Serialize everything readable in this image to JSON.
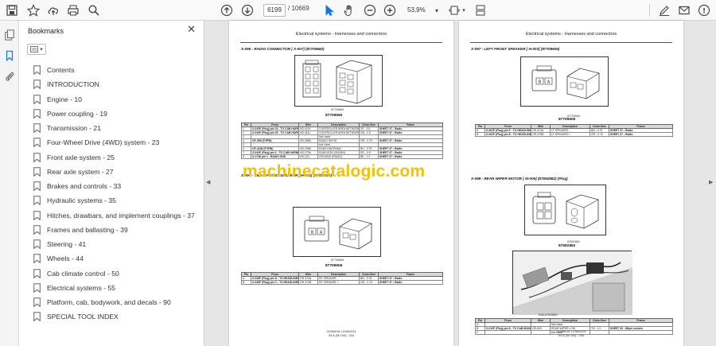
{
  "toolbar": {
    "current_page": "6199",
    "total_pages": "/ 10669",
    "zoom": "53,9%"
  },
  "bookmarks": {
    "title": "Bookmarks",
    "items": [
      "Contents",
      "INTRODUCTION",
      "Engine - 10",
      "Power coupling - 19",
      "Transmission - 21",
      "Four-Wheel Drive (4WD) system - 23",
      "Front axle system - 25",
      "Rear axle system - 27",
      "Brakes and controls - 33",
      "Hydraulic systems - 35",
      "Hitches, drawbars, and implement couplings - 37",
      "Frames and ballasting - 39",
      "Steering - 41",
      "Wheels - 44",
      "Cab climate control - 50",
      "Electrical systems - 55",
      "Platform, cab, bodywork, and decals - 90",
      "SPECIAL TOOL INDEX"
    ]
  },
  "left_page": {
    "header": "Electrical systems - Harnesses and connectors",
    "section1": "X-095 - RADIO CONNECTOR [ X-007] (87709660)",
    "caption1": "87709660",
    "partno1": "87709660",
    "table_headers": [
      "Pin",
      "From",
      "Wire",
      "Description",
      "Color-Size",
      "Frame"
    ],
    "table1": [
      [
        "1",
        "X-043F (Plug) pin 24 - TO CAB HARNESS (51146260)",
        "HD-410L",
        "CONTROLLER AREA NETWORK LINK HIGH",
        "YE - 0.5",
        "SHEET 37 - Radio"
      ],
      [
        "2",
        "X-043F (Plug) pin 25 - TO CAB HARNESS (51146260)",
        "HD-411L",
        "CONTROLLER AREA NETWORK LINK LOW",
        "GN - 0.5",
        "SHEET 37 - Radio"
      ],
      [
        "3",
        "",
        "",
        "Not Used",
        "",
        ""
      ],
      [
        "4",
        "OF-355 (PJPIN)",
        "HD-265A",
        "RADIO 30X B+",
        "OR - 0.75",
        "SHEET 37 - Radio"
      ],
      [
        "5",
        "",
        "",
        "Not Used",
        "",
        ""
      ],
      [
        "6",
        "OF-4238 (PJPIN)",
        "HD-238A",
        "RADIO ANTENNA",
        "BU - 0.75",
        "SHEET 37 - Radio"
      ],
      [
        "7",
        "X-043F (Plug) pin 3 - TO CAB HARNESS (51146260)",
        "HD-279A",
        "RADIO/15X (ON/IGN)",
        "RD - 0.5",
        "SHEET 37 - Radio"
      ],
      [
        "8",
        "X-1738 pin 1 - RADIO GND",
        "HD-223",
        "GROUND (RADIO)",
        "BK - 1.0",
        "SHEET 37 - Radio"
      ]
    ],
    "section2": "X-096 - RIGHT FRONT SPEAKER [ H-002] (87709606)",
    "caption2": "87709606",
    "partno2": "87709606",
    "table2": [
      [
        "A",
        "X-045F (Plug) pin D - TO HEADLINER SW HARNESS (87939641)",
        "OR-372A",
        "RF SPEAKER -",
        "BN - 0.75",
        "SHEET 37 - Radio"
      ],
      [
        "B",
        "X-045F (Plug) pin C - TO HEADLINER SW HARNESS (87939641)",
        "OR-373B",
        "RF SPEAKER +",
        "OR - 0.75",
        "SHEET 37 - Radio"
      ]
    ],
    "footer1": "32308018 12/08/2024",
    "footer2": "55.8 [55.100] / 344"
  },
  "right_page": {
    "header": "Electrical systems - Harnesses and connectors",
    "section1": "X-097 - LEFT FRONT SPEAKER [ H-003] (87709606)",
    "caption1": "87709606",
    "partno1": "87709606",
    "table_headers": [
      "Pin",
      "From",
      "Wire",
      "Description",
      "Color-Size",
      "Frame"
    ],
    "table1": [
      [
        "A",
        "X-061F (Plug) pin F - TO HEADLINER SW HARNESS (87939641)",
        "OR-374A",
        "LF SPEAKER -",
        "BN - 0.75",
        "SHEET 37 - Radio"
      ],
      [
        "B",
        "X-061F (Plug) pin E - TO HEADLINER SW HARNESS (87939641)",
        "OR-375B",
        "LF SPEAKER +",
        "OR - 0.75",
        "SHEET 37 - Radio"
      ]
    ],
    "section2": "X-098 - REAR WIPER MOTOR [ M-006] (87692862) (Plug)",
    "caption2": "87692862",
    "partno2": "87692862",
    "caption3": "RAIL87628862",
    "table2": [
      [
        "A",
        "",
        "",
        "Not Used",
        "",
        ""
      ],
      [
        "B",
        "X-015F (Plug) pin 6 - TO CAB MAIN HARNESS (87939641)",
        "OR-603",
        "REAR WIPER LOW",
        "TN - 1.0",
        "SHEET 30 - Wiper motors"
      ],
      [
        "C",
        "",
        "",
        "Not Used",
        "",
        ""
      ]
    ],
    "footer1": "32308018 12/08/2024",
    "footer2": "55.8 [55.100] / 345"
  },
  "watermark": "machinecatalogic.com",
  "colors": {
    "watermark": "#f2c300",
    "toolbar_bg": "#f9f9f9",
    "viewer_bg": "#e6e6e6"
  }
}
